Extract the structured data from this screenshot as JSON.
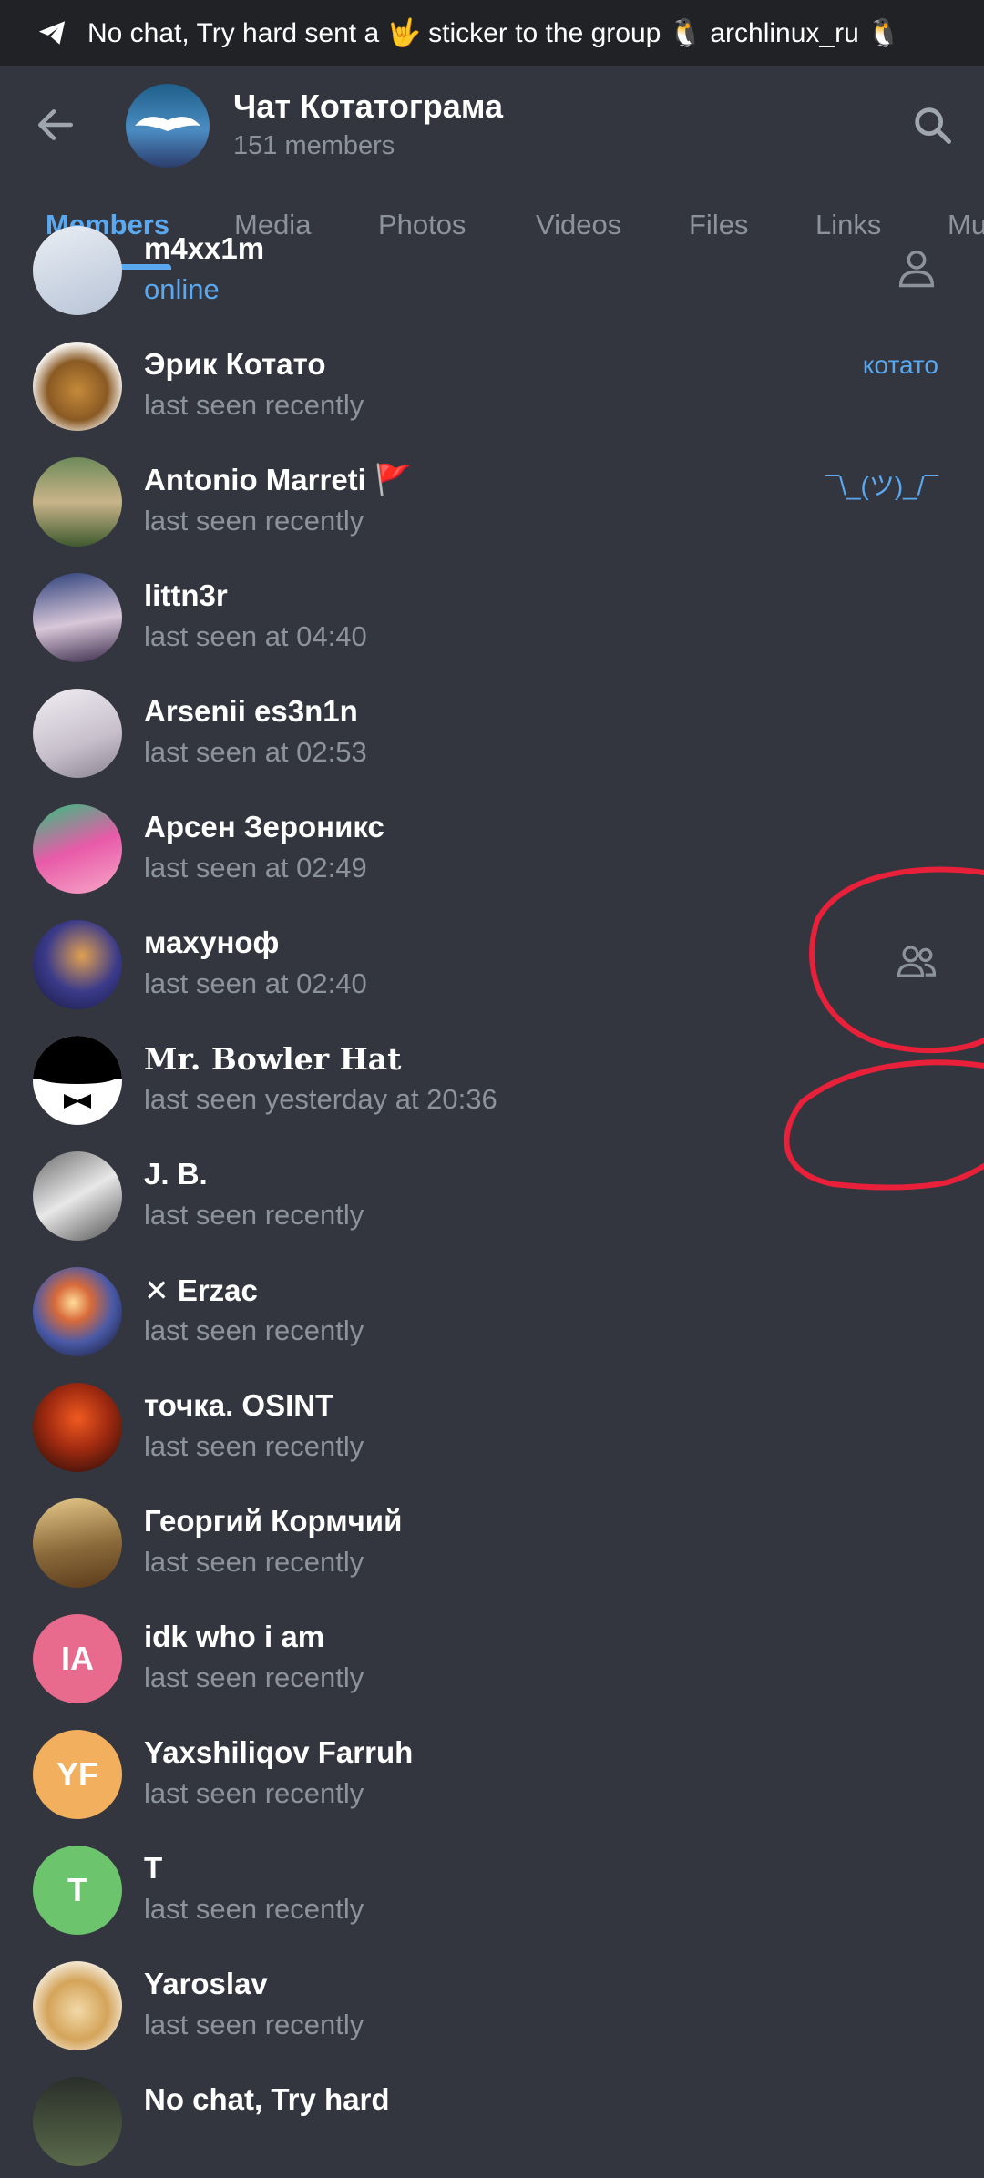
{
  "notification": {
    "text": "No chat, Try hard sent a 🤟 sticker to the group 🐧 archlinux_ru 🐧"
  },
  "header": {
    "title": "Чат Котатограма",
    "subtitle": "151 members"
  },
  "tabs": [
    {
      "label": "Members",
      "active": true
    },
    {
      "label": "Media"
    },
    {
      "label": "Photos"
    },
    {
      "label": "Videos"
    },
    {
      "label": "Files"
    },
    {
      "label": "Links"
    },
    {
      "label": "Mu"
    }
  ],
  "members": [
    {
      "name": "m4xx1m",
      "status": "online",
      "online": true,
      "icon": "person-icon"
    },
    {
      "name": "Эрик Котато",
      "status": "last seen recently",
      "role": "котато"
    },
    {
      "name": "Antonio Marreti 🚩",
      "status": "last seen recently",
      "role": "¯\\_(ツ)_/¯"
    },
    {
      "name": "littn3r",
      "status": "last seen at 04:40"
    },
    {
      "name": "Arsenii es3n1n",
      "status": "last seen at 02:53"
    },
    {
      "name": "Арсен Зероникс",
      "status": "last seen at 02:49"
    },
    {
      "name": "махуноф",
      "status": "last seen at 02:40",
      "icon": "group-icon"
    },
    {
      "name": "Mr. Bowler Hat",
      "status": "last seen yesterday at 20:36"
    },
    {
      "name": "J. B.",
      "status": "last seen recently"
    },
    {
      "name": "✕ Erzac",
      "status": "last seen recently"
    },
    {
      "name": "точка. OSINT",
      "status": "last seen recently"
    },
    {
      "name": "Георгий Кормчий",
      "status": "last seen recently"
    },
    {
      "name": "idk who i am",
      "status": "last seen recently",
      "initials": "IA",
      "color": "#e86b8e"
    },
    {
      "name": "Yaxshiliqov Farruh",
      "status": "last seen recently",
      "initials": "YF",
      "color": "#f2b05e"
    },
    {
      "name": "T",
      "status": "last seen recently",
      "initials": "T",
      "color": "#6cc46d"
    },
    {
      "name": "Yaroslav",
      "status": "last seen recently"
    },
    {
      "name": "No chat, Try hard",
      "status": ""
    }
  ],
  "colors": {
    "background": "#34363f",
    "accent": "#5aa8ef",
    "muted": "#8d939c",
    "annotation": "#e8203a"
  }
}
